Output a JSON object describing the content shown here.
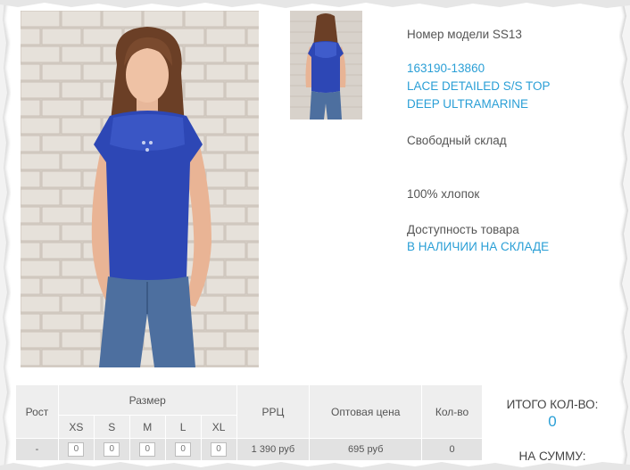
{
  "product": {
    "model_label": "Номер модели SS13",
    "article": "163190-13860",
    "name_line1": "LACE DETAILED S/S TOP",
    "name_line2": "DEEP ULTRAMARINE",
    "warehouse": "Свободный склад",
    "composition": "100% хлопок",
    "availability_label": "Доступность товара",
    "availability_value": "В НАЛИЧИИ НА СКЛАДЕ"
  },
  "table": {
    "header_height": "Рост",
    "header_size": "Размер",
    "sizes": [
      "XS",
      "S",
      "M",
      "L",
      "XL"
    ],
    "header_rrp": "РРЦ",
    "header_wholesale": "Оптовая цена",
    "header_qty": "Кол-во",
    "row": {
      "height": "-",
      "size_qty": [
        "0",
        "0",
        "0",
        "0",
        "0"
      ],
      "rrp": "1 390 руб",
      "wholesale": "695 руб",
      "qty": "0"
    }
  },
  "totals": {
    "total_qty_label": "ИТОГО КОЛ-ВО:",
    "total_qty_value": "0",
    "total_sum_label": "НА СУММУ:"
  },
  "colors": {
    "accent": "#2a9fd6",
    "shirt": "#2d47b5",
    "table_header": "#eeeeee",
    "table_row": "#e2e2e2"
  }
}
